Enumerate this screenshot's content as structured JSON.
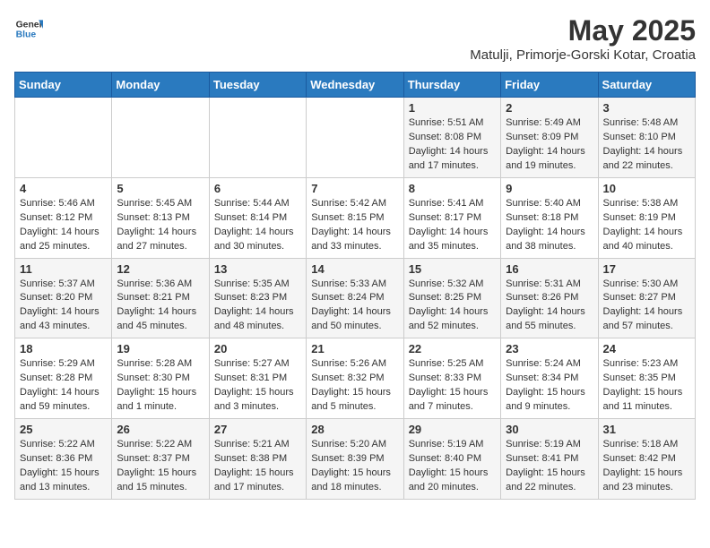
{
  "header": {
    "logo_general": "General",
    "logo_blue": "Blue",
    "title": "May 2025",
    "subtitle": "Matulji, Primorje-Gorski Kotar, Croatia"
  },
  "days_of_week": [
    "Sunday",
    "Monday",
    "Tuesday",
    "Wednesday",
    "Thursday",
    "Friday",
    "Saturday"
  ],
  "weeks": [
    [
      {
        "day": "",
        "content": ""
      },
      {
        "day": "",
        "content": ""
      },
      {
        "day": "",
        "content": ""
      },
      {
        "day": "",
        "content": ""
      },
      {
        "day": "1",
        "content": "Sunrise: 5:51 AM\nSunset: 8:08 PM\nDaylight: 14 hours and 17 minutes."
      },
      {
        "day": "2",
        "content": "Sunrise: 5:49 AM\nSunset: 8:09 PM\nDaylight: 14 hours and 19 minutes."
      },
      {
        "day": "3",
        "content": "Sunrise: 5:48 AM\nSunset: 8:10 PM\nDaylight: 14 hours and 22 minutes."
      }
    ],
    [
      {
        "day": "4",
        "content": "Sunrise: 5:46 AM\nSunset: 8:12 PM\nDaylight: 14 hours and 25 minutes."
      },
      {
        "day": "5",
        "content": "Sunrise: 5:45 AM\nSunset: 8:13 PM\nDaylight: 14 hours and 27 minutes."
      },
      {
        "day": "6",
        "content": "Sunrise: 5:44 AM\nSunset: 8:14 PM\nDaylight: 14 hours and 30 minutes."
      },
      {
        "day": "7",
        "content": "Sunrise: 5:42 AM\nSunset: 8:15 PM\nDaylight: 14 hours and 33 minutes."
      },
      {
        "day": "8",
        "content": "Sunrise: 5:41 AM\nSunset: 8:17 PM\nDaylight: 14 hours and 35 minutes."
      },
      {
        "day": "9",
        "content": "Sunrise: 5:40 AM\nSunset: 8:18 PM\nDaylight: 14 hours and 38 minutes."
      },
      {
        "day": "10",
        "content": "Sunrise: 5:38 AM\nSunset: 8:19 PM\nDaylight: 14 hours and 40 minutes."
      }
    ],
    [
      {
        "day": "11",
        "content": "Sunrise: 5:37 AM\nSunset: 8:20 PM\nDaylight: 14 hours and 43 minutes."
      },
      {
        "day": "12",
        "content": "Sunrise: 5:36 AM\nSunset: 8:21 PM\nDaylight: 14 hours and 45 minutes."
      },
      {
        "day": "13",
        "content": "Sunrise: 5:35 AM\nSunset: 8:23 PM\nDaylight: 14 hours and 48 minutes."
      },
      {
        "day": "14",
        "content": "Sunrise: 5:33 AM\nSunset: 8:24 PM\nDaylight: 14 hours and 50 minutes."
      },
      {
        "day": "15",
        "content": "Sunrise: 5:32 AM\nSunset: 8:25 PM\nDaylight: 14 hours and 52 minutes."
      },
      {
        "day": "16",
        "content": "Sunrise: 5:31 AM\nSunset: 8:26 PM\nDaylight: 14 hours and 55 minutes."
      },
      {
        "day": "17",
        "content": "Sunrise: 5:30 AM\nSunset: 8:27 PM\nDaylight: 14 hours and 57 minutes."
      }
    ],
    [
      {
        "day": "18",
        "content": "Sunrise: 5:29 AM\nSunset: 8:28 PM\nDaylight: 14 hours and 59 minutes."
      },
      {
        "day": "19",
        "content": "Sunrise: 5:28 AM\nSunset: 8:30 PM\nDaylight: 15 hours and 1 minute."
      },
      {
        "day": "20",
        "content": "Sunrise: 5:27 AM\nSunset: 8:31 PM\nDaylight: 15 hours and 3 minutes."
      },
      {
        "day": "21",
        "content": "Sunrise: 5:26 AM\nSunset: 8:32 PM\nDaylight: 15 hours and 5 minutes."
      },
      {
        "day": "22",
        "content": "Sunrise: 5:25 AM\nSunset: 8:33 PM\nDaylight: 15 hours and 7 minutes."
      },
      {
        "day": "23",
        "content": "Sunrise: 5:24 AM\nSunset: 8:34 PM\nDaylight: 15 hours and 9 minutes."
      },
      {
        "day": "24",
        "content": "Sunrise: 5:23 AM\nSunset: 8:35 PM\nDaylight: 15 hours and 11 minutes."
      }
    ],
    [
      {
        "day": "25",
        "content": "Sunrise: 5:22 AM\nSunset: 8:36 PM\nDaylight: 15 hours and 13 minutes."
      },
      {
        "day": "26",
        "content": "Sunrise: 5:22 AM\nSunset: 8:37 PM\nDaylight: 15 hours and 15 minutes."
      },
      {
        "day": "27",
        "content": "Sunrise: 5:21 AM\nSunset: 8:38 PM\nDaylight: 15 hours and 17 minutes."
      },
      {
        "day": "28",
        "content": "Sunrise: 5:20 AM\nSunset: 8:39 PM\nDaylight: 15 hours and 18 minutes."
      },
      {
        "day": "29",
        "content": "Sunrise: 5:19 AM\nSunset: 8:40 PM\nDaylight: 15 hours and 20 minutes."
      },
      {
        "day": "30",
        "content": "Sunrise: 5:19 AM\nSunset: 8:41 PM\nDaylight: 15 hours and 22 minutes."
      },
      {
        "day": "31",
        "content": "Sunrise: 5:18 AM\nSunset: 8:42 PM\nDaylight: 15 hours and 23 minutes."
      }
    ]
  ]
}
